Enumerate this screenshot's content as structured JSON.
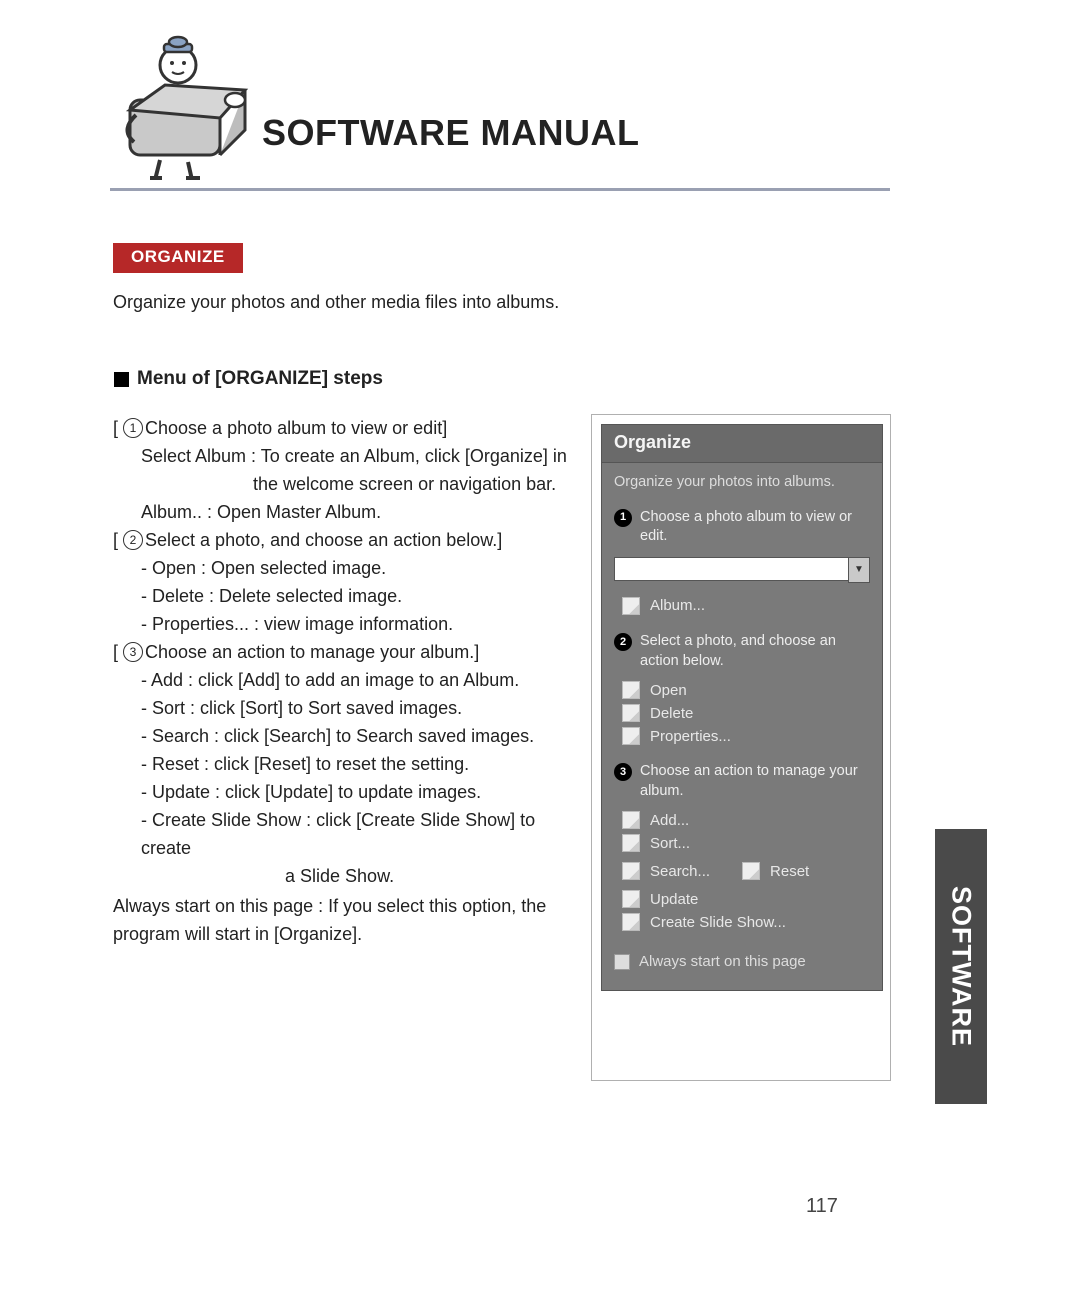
{
  "doc": {
    "title": "SOFTWARE MANUAL",
    "section_tag": "ORGANIZE",
    "intro": "Organize your photos and other media files into albums.",
    "subhead": "Menu of [ORGANIZE] steps",
    "page_number": "117",
    "side_tab": "SOFTWARE"
  },
  "steps": {
    "s1": {
      "num": "1",
      "head": "Choose a photo album to view or edit]",
      "line_a": "Select Album : To create an Album, click [Organize] in",
      "line_a2": "the welcome screen or navigation bar.",
      "line_b": "Album.. : Open Master Album."
    },
    "s2": {
      "num": "2",
      "head": "Select a photo, and choose an action below.]",
      "items": {
        "open": "- Open : Open selected image.",
        "del": "- Delete : Delete selected image.",
        "prop": "- Properties... : view image information."
      }
    },
    "s3": {
      "num": "3",
      "head": "Choose an action to manage your album.]",
      "items": {
        "add": "- Add : click [Add] to add an image to an Album.",
        "sort": "- Sort : click [Sort] to Sort saved images.",
        "search": "- Search : click [Search] to Search saved images.",
        "reset": "- Reset : click [Reset] to reset the setting.",
        "update": "- Update : click [Update] to update images.",
        "css1": "- Create Slide Show : click [Create Slide Show] to create",
        "css2": "a Slide Show."
      }
    },
    "footer": "Always start on this page : If you select this option, the program will start in [Organize]."
  },
  "panel": {
    "title": "Organize",
    "subtitle": "Organize your photos into albums.",
    "st1": {
      "num": "1",
      "text": "Choose a photo album to view or edit."
    },
    "album_link": "Album...",
    "st2": {
      "num": "2",
      "text": "Select a photo, and choose an action below."
    },
    "actions2": {
      "open": "Open",
      "del": "Delete",
      "prop": "Properties..."
    },
    "st3": {
      "num": "3",
      "text": "Choose an action to manage your album."
    },
    "actions3": {
      "add": "Add...",
      "sort": "Sort...",
      "search": "Search...",
      "reset": "Reset",
      "update": "Update",
      "css": "Create Slide Show..."
    },
    "checkbox_label": "Always start on this page"
  }
}
